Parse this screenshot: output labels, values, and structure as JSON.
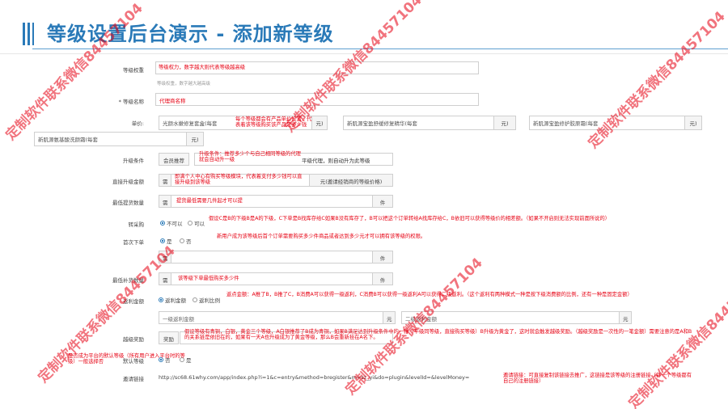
{
  "title": "等级设置后台演示 - 添加新等级",
  "colors": {
    "accent": "#2a7ab8",
    "annotation": "#e60012"
  },
  "watermark": "定制软件联系微信84457104",
  "form": {
    "weight": {
      "label": "等级权重",
      "note": "等级权力，数字越大则代表等级越高级",
      "hint": "等级权重，数字越大越高级"
    },
    "name": {
      "label": "* 等级名称",
      "value": "代理商名称"
    },
    "price": {
      "label": "单价:",
      "items": [
        {
          "placeholder": "光颜水嫩修复套盒(每套",
          "unit": "元)"
        },
        {
          "placeholder": "新肌源宝盈舒缓修复精华(每套",
          "unit": "元)"
        },
        {
          "placeholder": "新肌源宝盈修护胶原霜(每套",
          "unit": "元)"
        },
        {
          "placeholder": "新肌源氨基酸洗颜霜(每套",
          "unit": "元)"
        }
      ],
      "note": "每个等级都会有产品单价设置，代表着该等级购买该产品是多少钱"
    },
    "upgrade": {
      "label": "升级条件",
      "btn": "会员推荐",
      "suffix": "平级代理，则自动升为此等级",
      "note": "升级条件：推荐多少个与自己相同等级的代理就会自动升一级"
    },
    "direct": {
      "label": "直接升级金额",
      "prefix": "需",
      "suffix": "元(邀请经销商的等级价格)",
      "note": "即满个人中心有购买等级模块，代表着支付多少钱可以直接升级到该等级"
    },
    "minqty": {
      "label": "最低提货数量",
      "prefix": "需",
      "suffix": "件",
      "note": "提货最低需要几件起才可以提"
    },
    "transfer": {
      "label": "转采购",
      "opt_no": "不可以",
      "opt_yes": "可以",
      "note": "假设C是B的下级B是A的下级，C下单是B找库存给C如果B没有库存了，B可以把这个订单转给A找库存给C，B依旧可以获得等级价的相差额。（如果不开启则无法实现前面所说的）"
    },
    "firstorder": {
      "label": "首次下单",
      "opt_yes": "是",
      "opt_no": "否",
      "note": "新用户成为该等级后首个订单需要购买多少件商品或者达到多少元才可以拥有该等级的权限。"
    },
    "firstqty": {
      "prefix": "需",
      "suffix": "件"
    },
    "minrefill": {
      "label": "最低补货数量",
      "prefix": "需",
      "suffix": "件",
      "note": "该等级下单最低购买多少件"
    },
    "rebate": {
      "label": "返利金额",
      "opt_amount": "返利金额",
      "opt_ratio": "返利比例",
      "note": "返点金额：A推了B，B推了C，B消费A可以获得一级返利，C消费B可以获得一级返利A可以获得二级返利。（这个返利有两种模式一种是按下级消费额的比例，还有一种是固定金额）",
      "lvl1": "一级返利金额",
      "lvl2": "二级返利金额",
      "unit": "元"
    },
    "bonus": {
      "label": "越级奖励",
      "btn": "奖励",
      "note": "假设等级有青铜，白银，黄金三个等级，A白银推荐了B成为青铜，如果B满足达到升级条件中的一种（平级同等级，直接购买等级）B升级为黄金了，这时就会触发越级奖励。（越级奖励是一次性的一笔金额）需要注意的是A和B的关系链是依旧在的，如果有一天A也升级成为了黄金等级，那么B会重新挂在A名下。"
    },
    "default": {
      "label": "默认等级",
      "opt_no": "否",
      "opt_yes": "是",
      "note": "是否成为平台的默认等级（所有用户进入平台时的等级）一般选择否"
    },
    "invite": {
      "label": "邀请链接",
      "url": "http://sc68.61why.com/app/index.php?i=1&c=entry&method=bregister&m=sz_yi&do=plugin&levelId=&levelMoney=",
      "note": "邀请链接：可直接复制该链接去推广，这链接是该等级的注册链接（每一个等级都有自己的注册链接）"
    }
  }
}
